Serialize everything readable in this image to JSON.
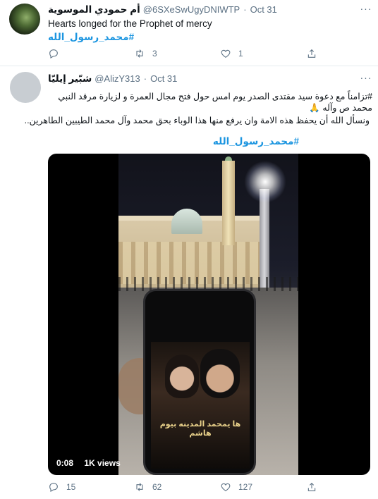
{
  "tweet1": {
    "display_name": "أم حمودي الموسوية",
    "handle": "@6SXeSwUgyDNIWTP",
    "separator": "·",
    "time": "Oct 31",
    "text": "Hearts longed for the Prophet of mercy",
    "hashtag": "#محمد_رسول_الله",
    "reply_count": "",
    "retweet_count": "3",
    "like_count": "1"
  },
  "tweet2": {
    "display_name": "شبّير إيليّا",
    "handle": "@AlizY313",
    "separator": "·",
    "time": "Oct 31",
    "line1": "#تزامناً مع دعوة سيد مقتدى الصدر يوم امس حول فتح مجال العمرة و لزيارة مرقد النبي محمد ص وآله 🙏",
    "line2": "ونسأل الله أن يحفظ هذه الامة وان يرفع منها هذا الوباء بحق محمد وآل محمد الطيبين الطاهرين..",
    "hashtag": "#محمد_رسول_الله",
    "video_time": "0:08",
    "video_views": "1K views",
    "screen_caption": "ها يمحمد المدينه بيوم هاشم",
    "reply_count": "15",
    "retweet_count": "62",
    "like_count": "127"
  },
  "icons": {
    "more": "more-dots-icon",
    "reply": "reply-bubble-icon",
    "retweet": "retweet-icon",
    "like": "heart-icon",
    "share": "share-upload-icon"
  },
  "colors": {
    "link": "#1b95e0",
    "muted": "#5b7083",
    "text": "#0f1419",
    "divider": "#e6ecf0"
  }
}
